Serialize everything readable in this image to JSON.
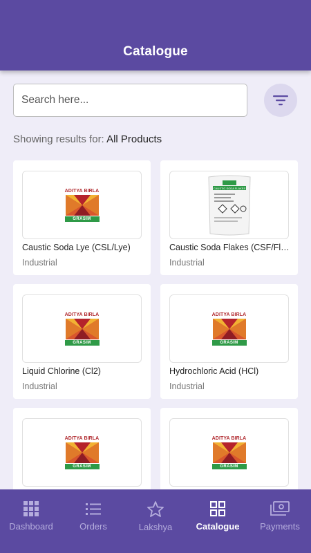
{
  "header": {
    "title": "Catalogue"
  },
  "search": {
    "placeholder": "Search here..."
  },
  "results": {
    "prefix": "Showing results for:",
    "value": "All Products"
  },
  "products": [
    {
      "name": "Caustic Soda Lye (CSL/Lye)",
      "category": "Industrial",
      "image": "aditya-birla-grasim-logo"
    },
    {
      "name": "Caustic Soda Flakes (CSF/Fla...",
      "category": "Industrial",
      "image": "caustic-soda-flakes-bag"
    },
    {
      "name": "Liquid Chlorine (Cl2)",
      "category": "Industrial",
      "image": "aditya-birla-grasim-logo"
    },
    {
      "name": "Hydrochloric Acid (HCl)",
      "category": "Industrial",
      "image": "aditya-birla-grasim-logo"
    },
    {
      "name": "",
      "category": "",
      "image": "aditya-birla-grasim-logo"
    },
    {
      "name": "",
      "category": "",
      "image": "aditya-birla-grasim-logo"
    }
  ],
  "logo": {
    "brand": "ADITYA BIRLA",
    "sub": "GRASIM"
  },
  "bag": {
    "label": "CAUSTIC SODA FLAKES"
  },
  "nav": [
    {
      "label": "Dashboard",
      "icon": "grid-dots-icon",
      "active": false
    },
    {
      "label": "Orders",
      "icon": "list-icon",
      "active": false
    },
    {
      "label": "Lakshya",
      "icon": "star-icon",
      "active": false
    },
    {
      "label": "Catalogue",
      "icon": "catalogue-grid-icon",
      "active": true
    },
    {
      "label": "Payments",
      "icon": "banknote-icon",
      "active": false
    }
  ],
  "colors": {
    "primary": "#5b4aa1",
    "background": "#efedf8",
    "nav_inactive": "#b5addd",
    "logo_red": "#b0282d",
    "logo_green": "#2f9a47"
  }
}
